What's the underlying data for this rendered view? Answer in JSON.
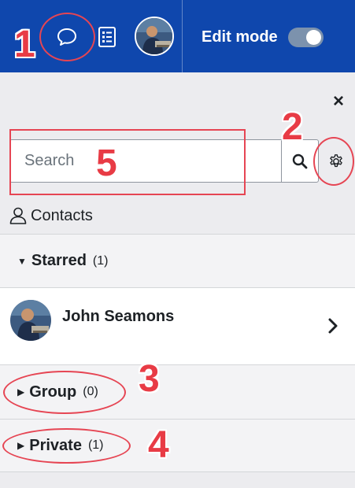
{
  "navbar": {
    "edit_mode_label": "Edit mode",
    "edit_mode_on": true,
    "brand_color": "#0f47ad"
  },
  "drawer": {
    "close_label": "×",
    "search": {
      "placeholder": "Search",
      "value": ""
    },
    "contacts_label": "Contacts",
    "sections": {
      "starred": {
        "title": "Starred",
        "count": "(1)",
        "expanded": true
      },
      "group": {
        "title": "Group",
        "count": "(0)",
        "expanded": false
      },
      "private": {
        "title": "Private",
        "count": "(1)",
        "expanded": false
      }
    },
    "starred_contacts": [
      {
        "name": "John Seamons"
      }
    ]
  },
  "annotations": {
    "color": "#e83b45",
    "labels": [
      "1",
      "2",
      "3",
      "4",
      "5"
    ]
  }
}
